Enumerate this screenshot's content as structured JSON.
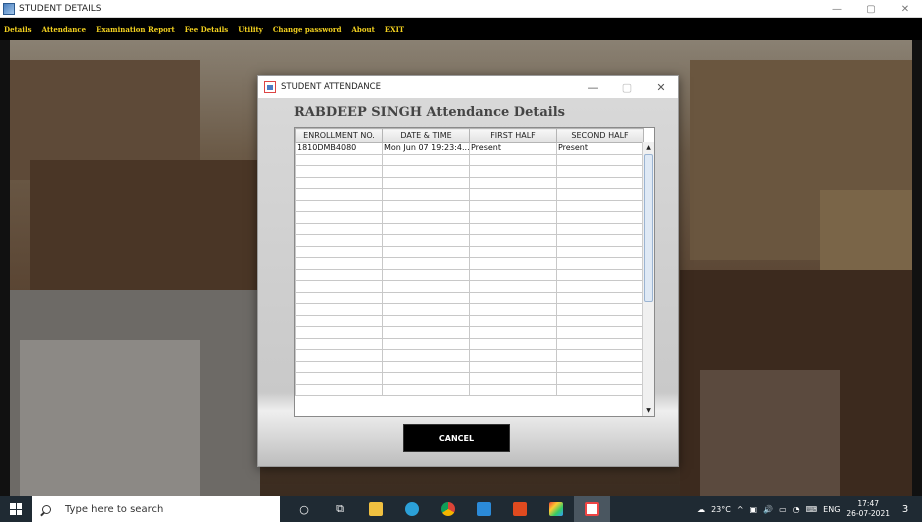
{
  "window": {
    "title": "STUDENT DETAILS",
    "controls": [
      "—",
      "▢",
      "✕"
    ]
  },
  "menu": [
    "Details",
    "Attendance",
    "Examination Report",
    "Fee Details",
    "Utility",
    "Change password",
    "About",
    "EXIT"
  ],
  "dialog": {
    "title": "STUDENT ATTENDANCE",
    "controls": [
      "—",
      "▢",
      "✕"
    ],
    "heading": "RABDEEP SINGH Attendance Details",
    "columns": [
      "ENROLLMENT NO.",
      "DATE & TIME",
      "FIRST HALF",
      "SECOND HALF"
    ],
    "rows": [
      [
        "1810DMB4080",
        "Mon Jun 07 19:23:4...",
        "Present",
        "Present"
      ]
    ],
    "empty_rows": 21,
    "cancel_label": "CANCEL"
  },
  "taskbar": {
    "search_placeholder": "Type here to search",
    "icons": [
      "cortana-icon",
      "task-view-icon",
      "file-explorer-icon",
      "edge-icon",
      "chrome-icon",
      "vscode-icon",
      "office-icon",
      "app-cube-icon",
      "java-icon"
    ],
    "weather": "23°C",
    "lang": "ENG",
    "time": "17:47",
    "date": "26-07-2021",
    "notifications": "3"
  },
  "colors": {
    "menu_text": "#f4d21f",
    "menubar": "#000000",
    "taskbar": "#1f2a33"
  }
}
